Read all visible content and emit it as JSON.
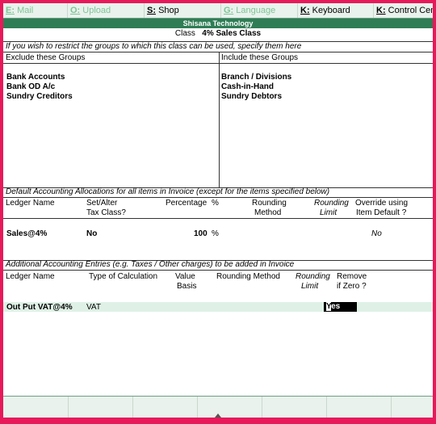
{
  "toolbar": {
    "mail": {
      "key": "E:",
      "label": "Mail"
    },
    "upload": {
      "key": "O:",
      "label": "Upload"
    },
    "shop": {
      "key": "S:",
      "label": "Shop"
    },
    "language": {
      "key": "G:",
      "label": "Language"
    },
    "keyboard": {
      "key": "K:",
      "label": "Keyboard"
    },
    "control": {
      "key": "K:",
      "label": "Control Cent"
    }
  },
  "company": "Shisana Technology",
  "class_line": {
    "label": "Class",
    "value": "4% Sales Class"
  },
  "instruction": "If you wish to restrict the groups to which this class can be used, specify them here",
  "exclude": {
    "header": "Exclude these Groups",
    "items": [
      "Bank Accounts",
      "Bank OD A/c",
      "Sundry Creditors"
    ]
  },
  "include": {
    "header": "Include these Groups",
    "items": [
      "Branch / Divisions",
      "Cash-in-Hand",
      "Sundry Debtors"
    ]
  },
  "alloc": {
    "section_title": "Default Accounting Allocations for all items in Invoice (except for the items specified below)",
    "col_ledger": "Ledger Name",
    "col_setalter_1": "Set/Alter",
    "col_setalter_2": "Tax Class?",
    "col_percentage": "Percentage",
    "col_pct_sym": "%",
    "col_rounding_1": "Rounding",
    "col_rounding_2": "Method",
    "col_limit_1": "Rounding",
    "col_limit_2": "Limit",
    "col_override_1": "Override using",
    "col_override_2": "Item Default ?",
    "row": {
      "ledger": "Sales@4%",
      "setalter": "No",
      "percentage": "100",
      "pct_sym": "%",
      "override": "No"
    }
  },
  "additional": {
    "section_title": "Additional Accounting Entries (e.g. Taxes / Other charges) to be added in Invoice",
    "col_ledger": "Ledger Name",
    "col_type": "Type of Calculation",
    "col_value_1": "Value",
    "col_value_2": "Basis",
    "col_rounding": "Rounding Method",
    "col_limit_1": "Rounding",
    "col_limit_2": "Limit",
    "col_remove_1": "Remove",
    "col_remove_2": "if Zero ?",
    "row": {
      "ledger": "Out Put VAT@4%",
      "type": "VAT",
      "remove_cursor": "Y",
      "remove_rest": "es"
    }
  },
  "colors": {
    "border": "#e8195a",
    "title_bar": "#2f7d55",
    "highlight": "#dff1e6"
  }
}
